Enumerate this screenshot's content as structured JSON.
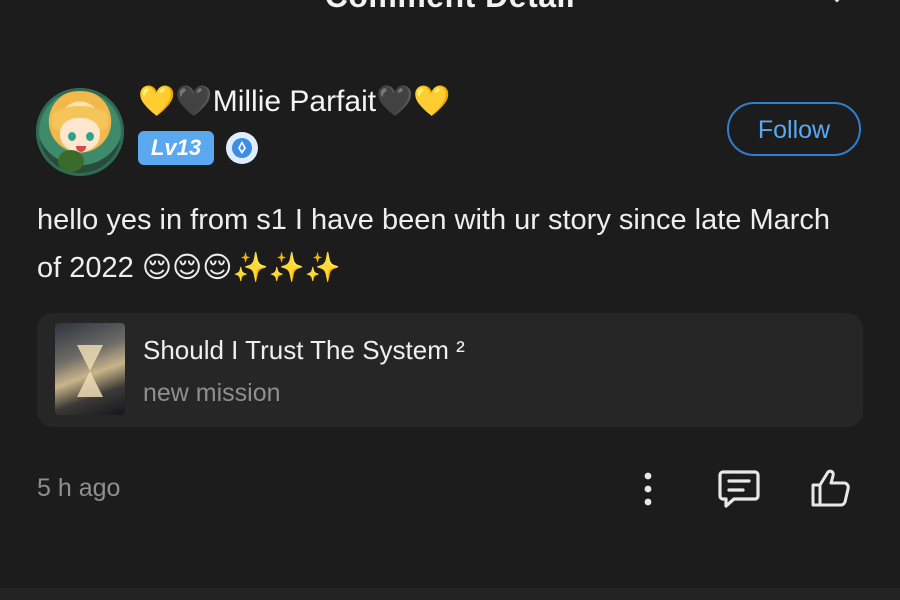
{
  "header": {
    "title": "Comment Detail"
  },
  "comment": {
    "user": {
      "name": "💛🖤Millie Parfait🖤💛",
      "level": "Lv13"
    },
    "follow_label": "Follow",
    "text": "hello yes in from s1 I have been with ur story since late March of 2022 😌😌😌✨✨✨",
    "story": {
      "title": "Should I Trust The System ²",
      "subtitle": "new mission"
    },
    "timestamp": "5 h ago"
  },
  "icons": {
    "close": "close-icon",
    "badge": "vip-badge-icon",
    "more": "more-vertical-icon",
    "reply": "reply-icon",
    "like": "thumbs-up-icon"
  },
  "colors": {
    "background": "#1c1c1c",
    "accent": "#2d7fd0",
    "level_badge": "#5aa8f0",
    "card": "#262626",
    "muted_text": "#8f8f8f"
  }
}
